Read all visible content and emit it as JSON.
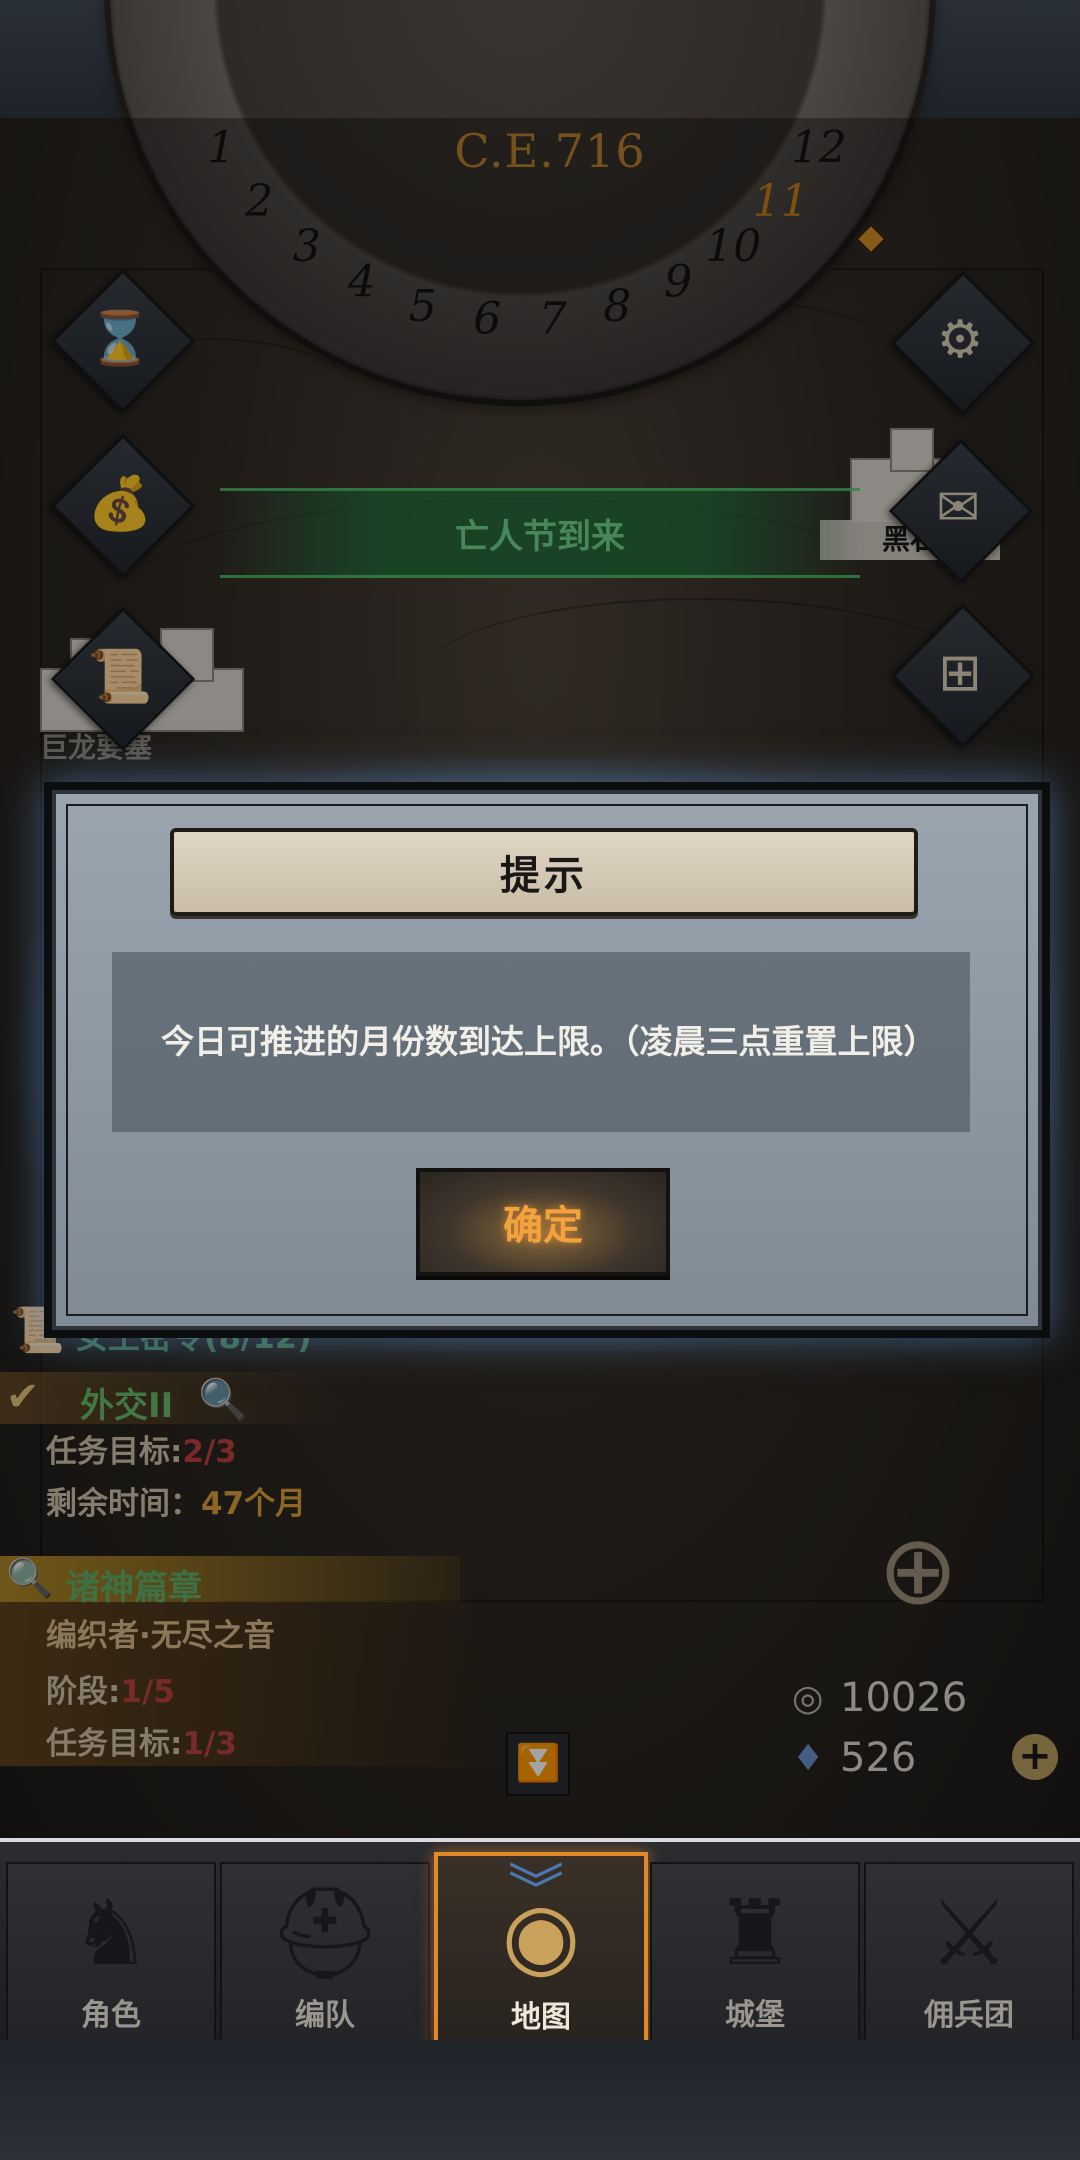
{
  "header": {
    "year": "C.E.716"
  },
  "calendar": {
    "months": [
      "1",
      "2",
      "3",
      "4",
      "5",
      "6",
      "7",
      "8",
      "9",
      "10",
      "11",
      "12"
    ],
    "current_month": "11"
  },
  "side_icons": {
    "left": [
      "hourglass-icon",
      "money-bag-icon",
      "scroll-icon"
    ],
    "right": [
      "gear-icon",
      "mail-icon",
      "gate-icon"
    ]
  },
  "event": {
    "banner_text": "亡人节到来"
  },
  "map": {
    "location_right": "黑石",
    "location_left": "巨龙要塞"
  },
  "dialog": {
    "title": "提示",
    "message": "今日可推进的月份数到达上限。（凌晨三点重置上限）",
    "confirm_label": "确定"
  },
  "quests": [
    {
      "name": "女王密令(8/12)",
      "type": "scroll"
    },
    {
      "name": "外交II",
      "target_label": "任务目标:",
      "target_value": "2/3",
      "time_label": "剩余时间：",
      "time_value": "47个月"
    },
    {
      "name": "诸神篇章",
      "subtitle": "编织者·无尽之音",
      "stage_label": "阶段:",
      "stage_value": "1/5",
      "target_label": "任务目标:",
      "target_value": "1/3"
    }
  ],
  "currency": {
    "silver": "10026",
    "crystal": "526"
  },
  "nav": [
    {
      "label": "角色",
      "icon": "knight-icon"
    },
    {
      "label": "编队",
      "icon": "helmet-icon"
    },
    {
      "label": "地图",
      "icon": "globe-icon",
      "active": true
    },
    {
      "label": "城堡",
      "icon": "castle-icon"
    },
    {
      "label": "佣兵团",
      "icon": "sword-icon"
    }
  ]
}
